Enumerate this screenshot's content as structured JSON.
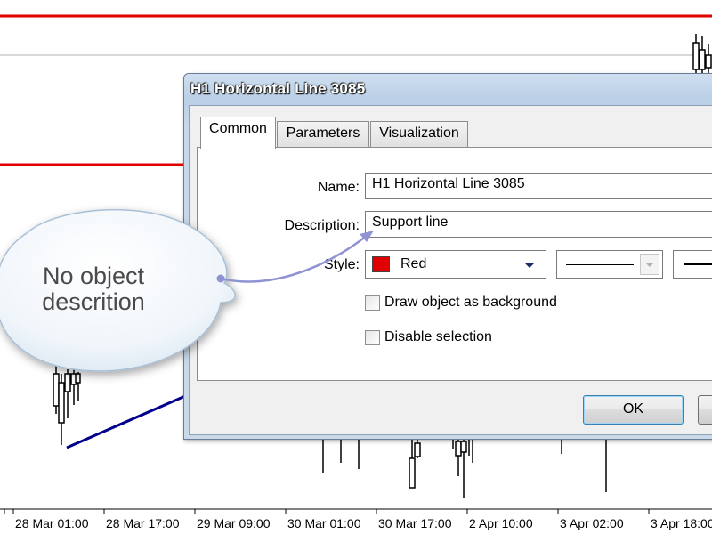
{
  "chart": {
    "x_axis_labels": [
      "28 Mar 01:00",
      "28 Mar 17:00",
      "29 Mar 09:00",
      "30 Mar 01:00",
      "30 Mar 17:00",
      "2 Apr 10:00",
      "3 Apr 02:00",
      "3 Apr 18:00"
    ],
    "colors": {
      "horizontal_line": "#e00000",
      "trend_line": "#00008b",
      "candles": "#000000"
    }
  },
  "dialog": {
    "title": "H1 Horizontal Line 3085",
    "tabs": [
      {
        "label": "Common",
        "active": true
      },
      {
        "label": "Parameters",
        "active": false
      },
      {
        "label": "Visualization",
        "active": false
      }
    ],
    "fields": {
      "name_label": "Name:",
      "name_value": "H1 Horizontal Line 3085",
      "description_label": "Description:",
      "description_value": "Support line",
      "style_label": "Style:",
      "style_color_name": "Red",
      "style_color_hex": "#e00000"
    },
    "checkboxes": [
      {
        "label": "Draw object as background",
        "checked": false
      },
      {
        "label": "Disable selection",
        "checked": false
      }
    ],
    "buttons": {
      "ok_label": "OK"
    }
  },
  "callout": {
    "text": "No object descrition"
  }
}
